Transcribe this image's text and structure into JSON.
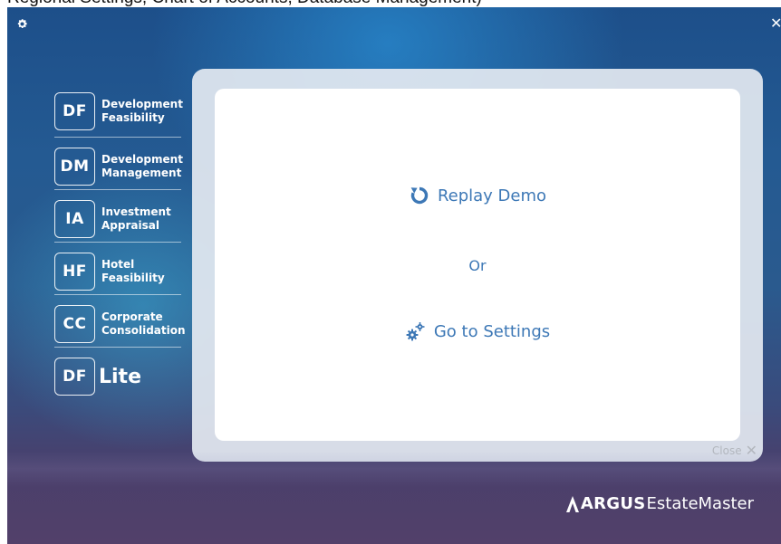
{
  "top_caption": "Regional Settings, Chart of Accounts, Database Management)",
  "window": {
    "settings_icon": "gear-icon",
    "close_symbol": "✕"
  },
  "modules": [
    {
      "badge": "DF",
      "line1": "Development",
      "line2": "Feasibility"
    },
    {
      "badge": "DM",
      "line1": "Development",
      "line2": "Management"
    },
    {
      "badge": "IA",
      "line1": "Investment",
      "line2": "Appraisal"
    },
    {
      "badge": "HF",
      "line1": "Hotel",
      "line2": "Feasibility"
    },
    {
      "badge": "CC",
      "line1": "Corporate",
      "line2": "Consolidation"
    },
    {
      "badge": "DF",
      "lite": "Lite"
    }
  ],
  "dialog": {
    "replay_label": "Replay Demo",
    "or_label": "Or",
    "settings_label": "Go to Settings",
    "close_label": "Close",
    "close_symbol": "✕",
    "accent_color": "#3d78b6"
  },
  "brand": {
    "argus": "ARGUS",
    "product": "EstateMaster"
  }
}
